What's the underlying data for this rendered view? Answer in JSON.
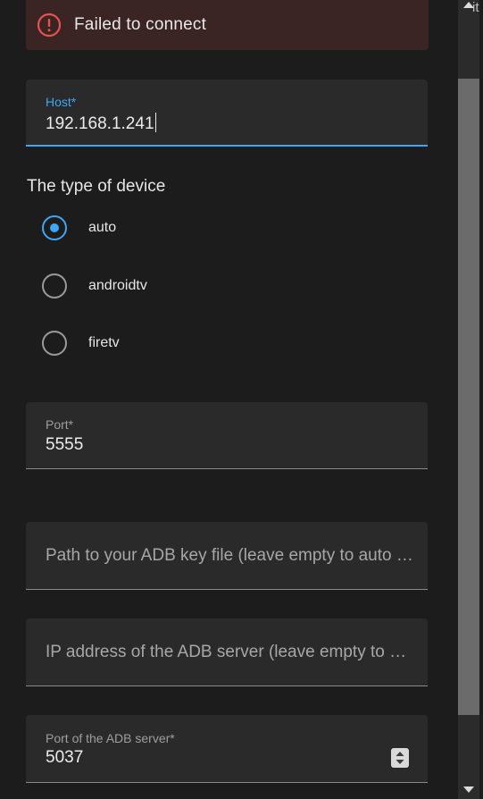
{
  "error": {
    "message": "Failed to connect",
    "icon": "alert-circle-icon",
    "color": "#e5534b"
  },
  "host_field": {
    "label": "Host*",
    "value": "192.168.1.241"
  },
  "device_type": {
    "title": "The type of device",
    "options": [
      {
        "label": "auto",
        "checked": true
      },
      {
        "label": "androidtv",
        "checked": false
      },
      {
        "label": "firetv",
        "checked": false
      }
    ]
  },
  "port_field": {
    "label": "Port*",
    "value": "5555"
  },
  "adb_key_field": {
    "placeholder": "Path to your ADB key file (leave empty to auto …"
  },
  "adb_server_ip_field": {
    "placeholder": "IP address of the ADB server (leave empty to n…"
  },
  "adb_server_port_field": {
    "label": "Port of the ADB server*",
    "value": "5037"
  },
  "edge_text": "it",
  "accent_color": "#3ea6f2"
}
